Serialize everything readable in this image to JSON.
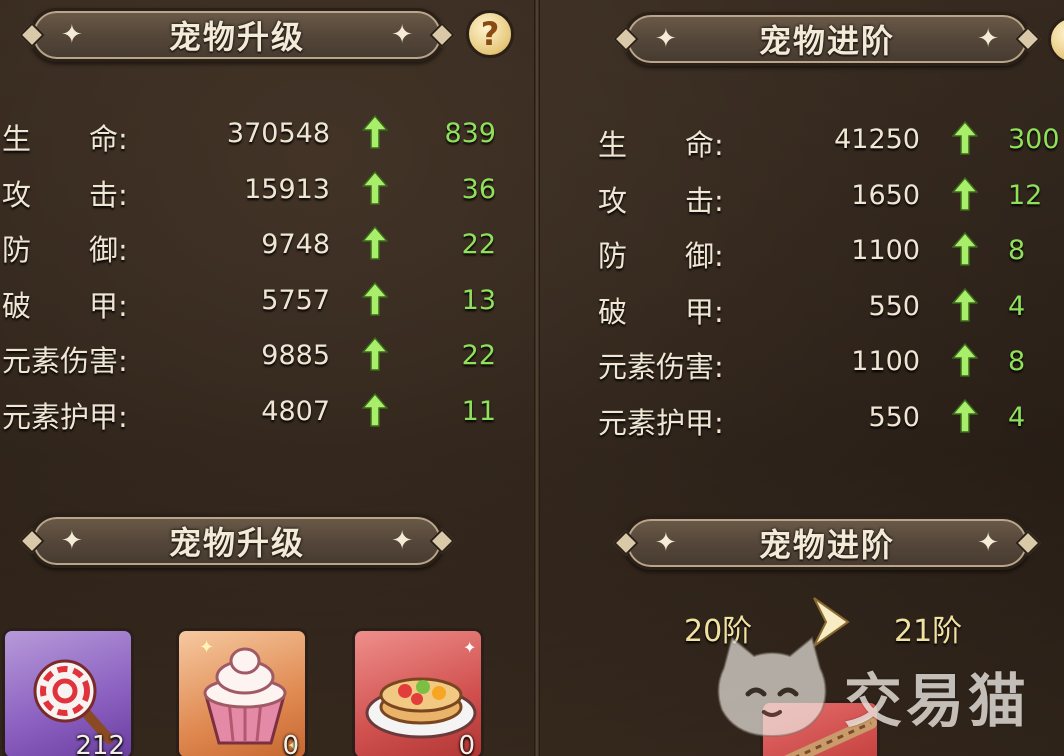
{
  "left_panel": {
    "banner_title": "宠物升级",
    "help_icon": "?",
    "stats": [
      {
        "label": "生　　命:",
        "value": "370548",
        "increase": "839"
      },
      {
        "label": "攻　　击:",
        "value": "15913",
        "increase": "36"
      },
      {
        "label": "防　　御:",
        "value": "9748",
        "increase": "22"
      },
      {
        "label": "破　　甲:",
        "value": "5757",
        "increase": "13"
      },
      {
        "label": "元素伤害:",
        "value": "9885",
        "increase": "22"
      },
      {
        "label": "元素护甲:",
        "value": "4807",
        "increase": "11"
      }
    ],
    "section_title": "宠物升级",
    "items": [
      {
        "icon": "lollipop-icon",
        "count": "212"
      },
      {
        "icon": "cupcake-icon",
        "count": "0"
      },
      {
        "icon": "cake-icon",
        "count": "0"
      }
    ]
  },
  "right_panel": {
    "banner_title": "宠物进阶",
    "stats": [
      {
        "label": "生　　命:",
        "value": "41250",
        "increase": "300"
      },
      {
        "label": "攻　　击:",
        "value": "1650",
        "increase": "12"
      },
      {
        "label": "防　　御:",
        "value": "1100",
        "increase": "8"
      },
      {
        "label": "破　　甲:",
        "value": "550",
        "increase": "4"
      },
      {
        "label": "元素伤害:",
        "value": "1100",
        "increase": "8"
      },
      {
        "label": "元素护甲:",
        "value": "550",
        "increase": "4"
      }
    ],
    "section_title": "宠物进阶",
    "stage_from": "20阶",
    "stage_to": "21阶"
  },
  "watermark": {
    "text": "交易猫"
  },
  "colors": {
    "increase_green": "#8fe05a",
    "stage_gold": "#f2e2a2"
  }
}
